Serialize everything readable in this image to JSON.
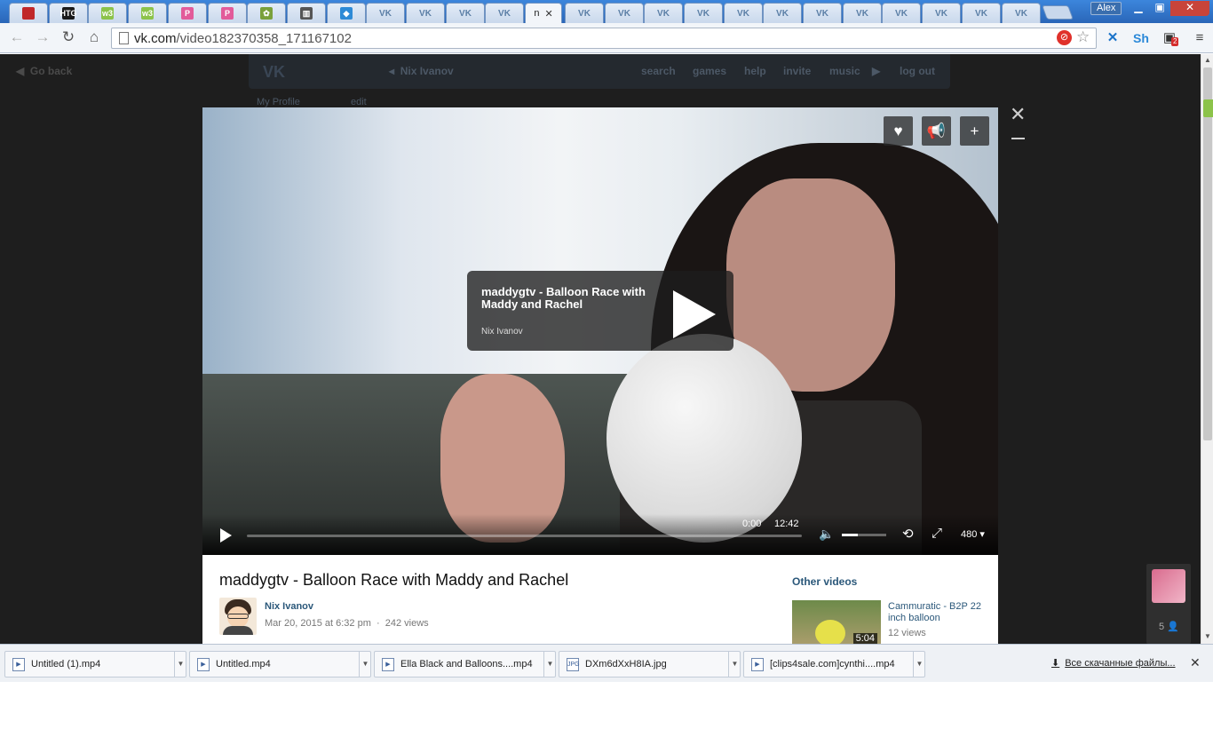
{
  "browser": {
    "user_name": "Alex",
    "active_tab_title": "n",
    "active_tab_close": "✕",
    "url_host": "vk.com",
    "url_path": "/video182370358_171167102",
    "extensions": {
      "badge_count": "2",
      "sh_label": "Sh"
    },
    "tabs": [
      {
        "icon": "red-book-icon",
        "color": "#c0282a",
        "label": ""
      },
      {
        "icon": "htg-icon",
        "color": "#1a1a1a",
        "label": "HTG"
      },
      {
        "icon": "w3-icon",
        "color": "#8cc34a",
        "label": "w3"
      },
      {
        "icon": "w3-icon",
        "color": "#8cc34a",
        "label": "w3"
      },
      {
        "icon": "p-icon",
        "color": "#e25b9a",
        "label": "P"
      },
      {
        "icon": "p-icon",
        "color": "#e25b9a",
        "label": "P"
      },
      {
        "icon": "puzzle-icon",
        "color": "#7aa03a",
        "label": "✿"
      },
      {
        "icon": "bookshelf-icon",
        "color": "#555555",
        "label": "▥"
      },
      {
        "icon": "book-icon",
        "color": "#2d8ad6",
        "label": "◆"
      },
      {
        "icon": "vk-icon",
        "color": "#5b7fa6",
        "label": "VK"
      },
      {
        "icon": "vk-icon",
        "color": "#5b7fa6",
        "label": "VK"
      },
      {
        "icon": "vk-icon",
        "color": "#5b7fa6",
        "label": "VK"
      },
      {
        "icon": "vk-icon",
        "color": "#5b7fa6",
        "label": "VK"
      }
    ],
    "tabs_after": 12
  },
  "vk": {
    "go_back": "Go back",
    "owner_name": "Nix Ivanov",
    "nav": [
      "search",
      "games",
      "help",
      "invite",
      "music",
      "log out"
    ],
    "my_profile": "My Profile",
    "edit": "edit"
  },
  "video": {
    "title": "maddygtv - Balloon Race with Maddy and Rachel",
    "author": "Nix Ivanov",
    "date": "Mar 20, 2015 at 6:32 pm",
    "views": "242 views",
    "time_current": "0:00",
    "time_duration": "12:42",
    "quality": "480",
    "volume_level": 0.35,
    "progress_fraction": 0.0
  },
  "other_videos": {
    "heading": "Other videos",
    "items": [
      {
        "title": "Cammuratic - B2P 22 inch balloon",
        "views": "12 views",
        "duration": "5:04"
      }
    ]
  },
  "side_panel": {
    "count": "5"
  },
  "downloads": {
    "items": [
      {
        "name": "Untitled (1).mp4",
        "type": "mp4"
      },
      {
        "name": "Untitled.mp4",
        "type": "mp4"
      },
      {
        "name": "Ella Black and Balloons....mp4",
        "type": "mp4"
      },
      {
        "name": "DXm6dXxH8IA.jpg",
        "type": "jpg"
      },
      {
        "name": "[clips4sale.com]cynthi....mp4",
        "type": "mp4"
      }
    ],
    "show_all": "Все скачанные файлы..."
  }
}
